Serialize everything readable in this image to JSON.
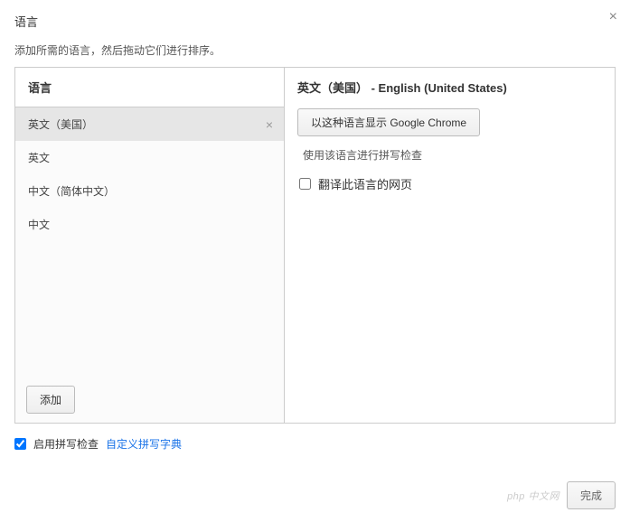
{
  "dialog": {
    "title": "语言",
    "subtitle": "添加所需的语言，然后拖动它们进行排序。"
  },
  "left": {
    "header": "语言",
    "items": [
      {
        "label": "英文（美国）",
        "selected": true
      },
      {
        "label": "英文",
        "selected": false
      },
      {
        "label": "中文（简体中文）",
        "selected": false
      },
      {
        "label": "中文",
        "selected": false
      }
    ],
    "add_label": "添加"
  },
  "right": {
    "header": "英文（美国） - English (United States)",
    "display_button": "以这种语言显示 Google Chrome",
    "spellcheck_line": "使用该语言进行拼写检查",
    "translate_checkbox": "翻译此语言的网页"
  },
  "footer": {
    "enable_spellcheck": "启用拼写检查",
    "custom_dict_link": "自定义拼写字典"
  },
  "bottom": {
    "watermark": "php 中文网",
    "done_button": "完成"
  }
}
